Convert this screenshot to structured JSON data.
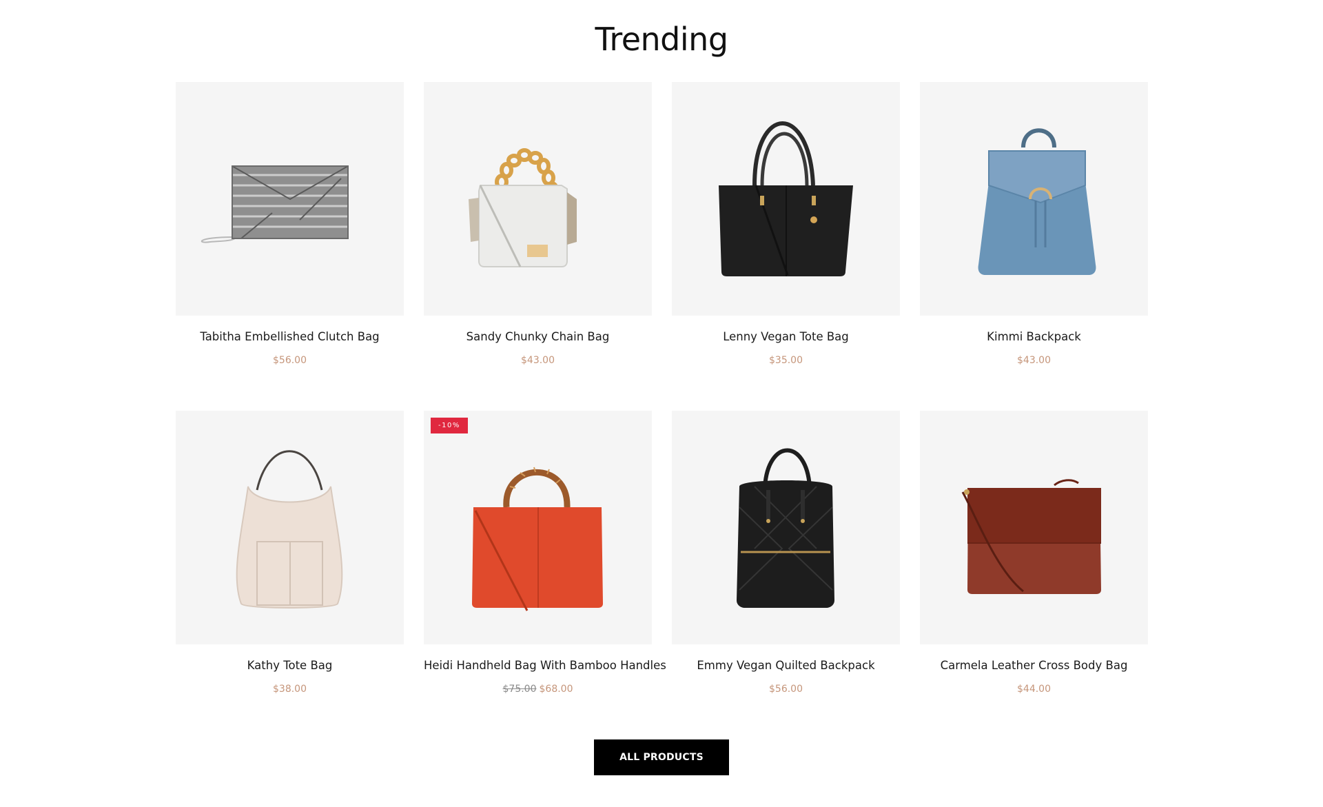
{
  "section": {
    "title": "Trending"
  },
  "products": [
    {
      "name": "Tabitha Embellished Clutch Bag",
      "price": "$56.00",
      "icon": "clutch-bag-icon"
    },
    {
      "name": "Sandy Chunky Chain Bag",
      "price": "$43.00",
      "icon": "chain-bag-icon"
    },
    {
      "name": "Lenny Vegan Tote Bag",
      "price": "$35.00",
      "icon": "tote-bag-icon"
    },
    {
      "name": "Kimmi Backpack",
      "price": "$43.00",
      "icon": "backpack-icon"
    },
    {
      "name": "Kathy Tote Bag",
      "price": "$38.00",
      "icon": "hobo-tote-icon"
    },
    {
      "name": "Heidi Handheld Bag With Bamboo Handles",
      "old_price": "$75.00",
      "price": "$68.00",
      "badge": "-10%",
      "icon": "bamboo-handle-bag-icon"
    },
    {
      "name": "Emmy Vegan Quilted Backpack",
      "price": "$56.00",
      "icon": "quilted-backpack-icon"
    },
    {
      "name": "Carmela Leather Cross Body Bag",
      "price": "$44.00",
      "icon": "cross-body-bag-icon"
    }
  ],
  "actions": {
    "all_products": "ALL PRODUCTS"
  },
  "colors": {
    "price": "#c5957a",
    "badge": "#e0283f",
    "card_bg": "#f5f5f5",
    "button_bg": "#000000"
  }
}
